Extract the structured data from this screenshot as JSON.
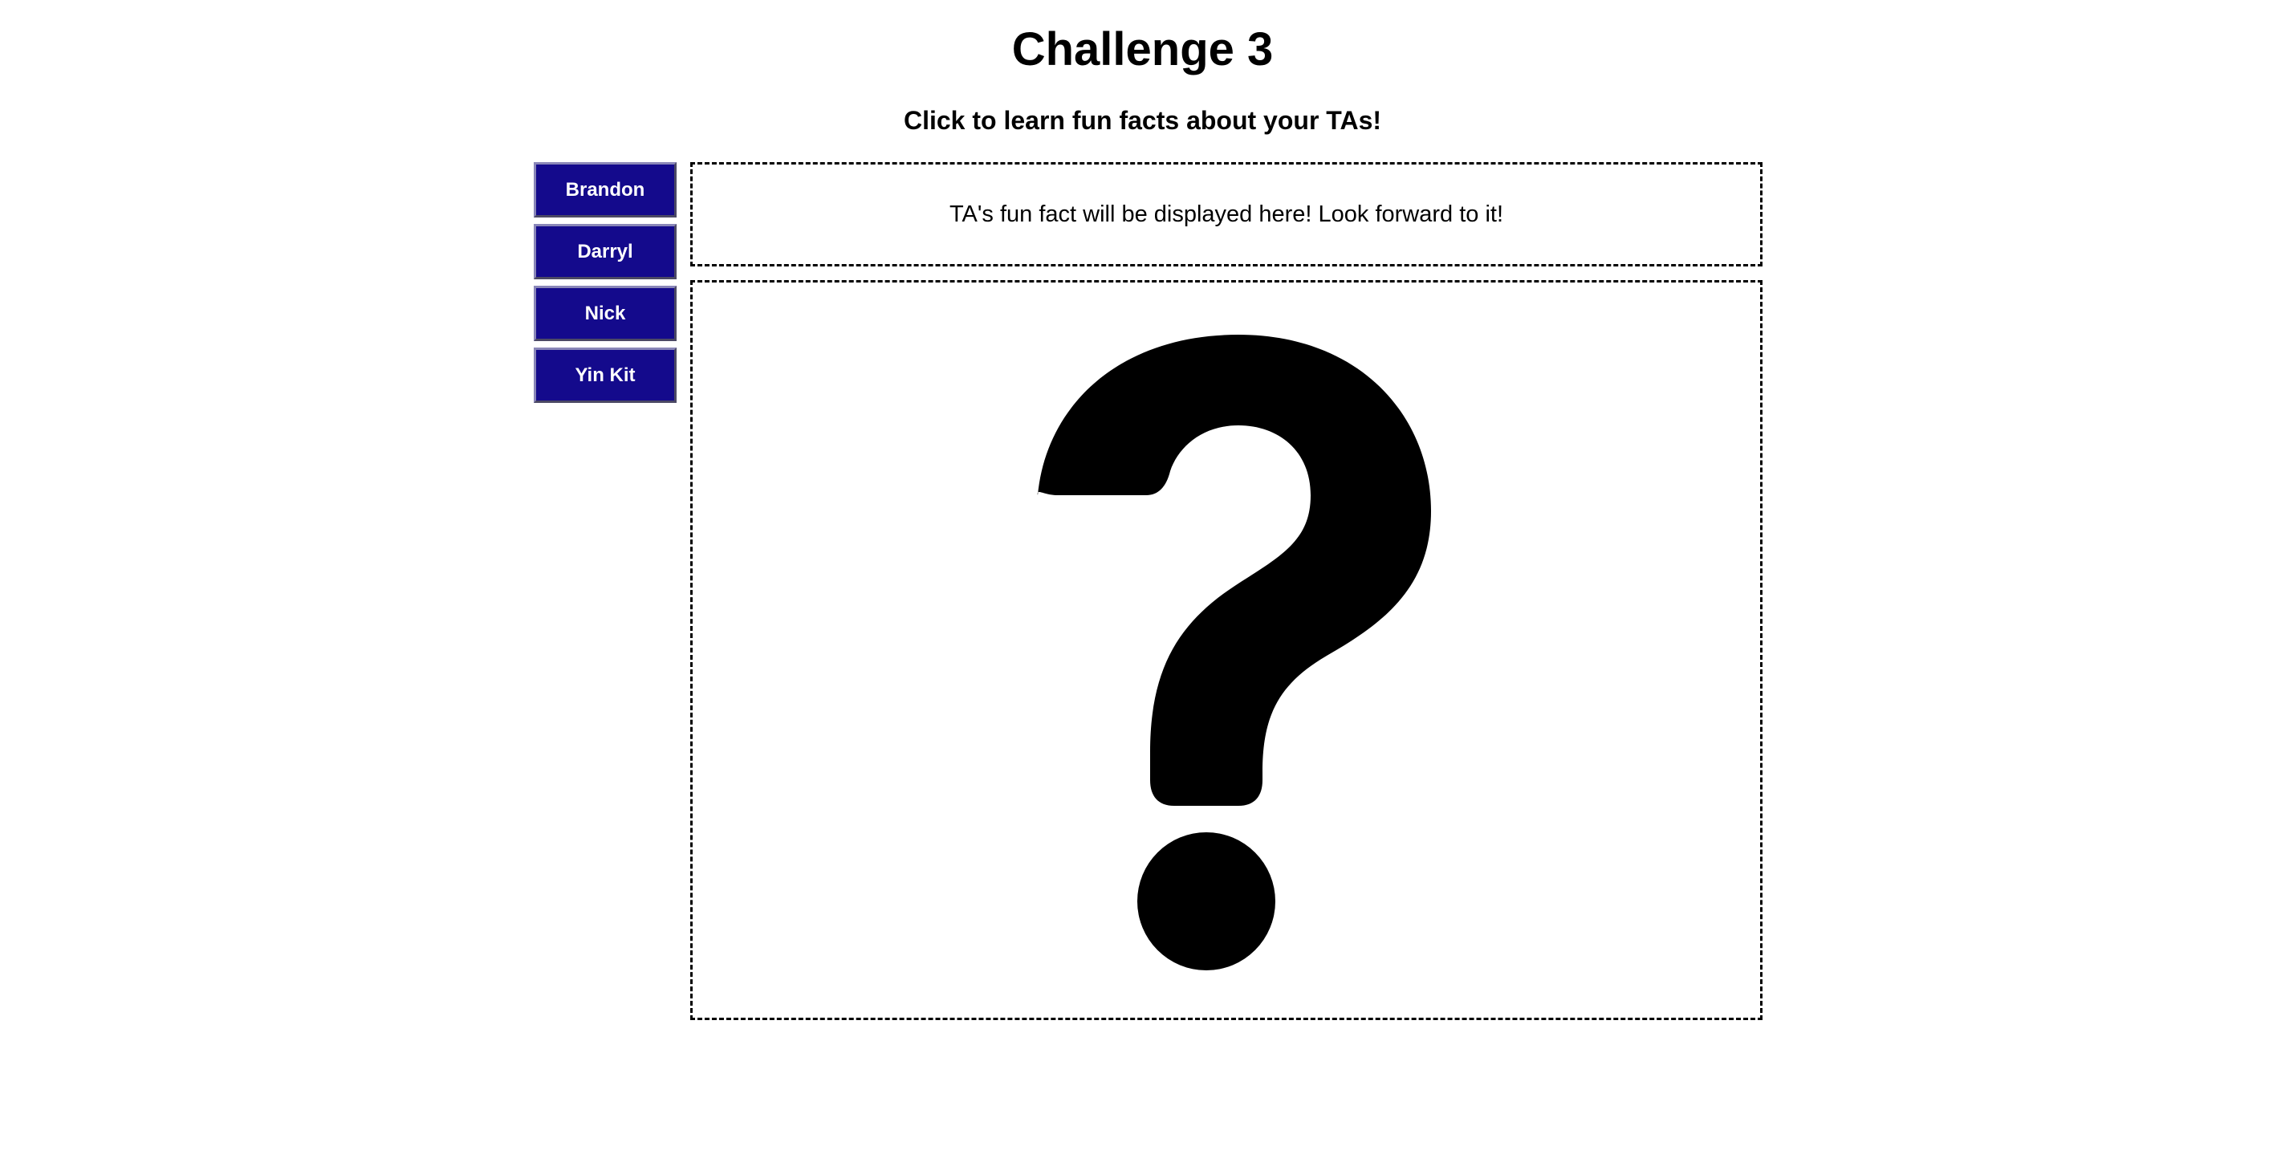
{
  "header": {
    "title": "Challenge 3",
    "subtitle": "Click to learn fun facts about your TAs!"
  },
  "sidebar": {
    "buttons": [
      {
        "label": "Brandon"
      },
      {
        "label": "Darryl"
      },
      {
        "label": "Nick"
      },
      {
        "label": "Yin Kit"
      }
    ],
    "button_color": "#140a8c",
    "button_text_color": "#ffffff"
  },
  "fact": {
    "text": "TA's fun fact will be displayed here! Look forward to it!"
  },
  "image": {
    "icon": "question-mark-icon",
    "color": "#000000"
  }
}
